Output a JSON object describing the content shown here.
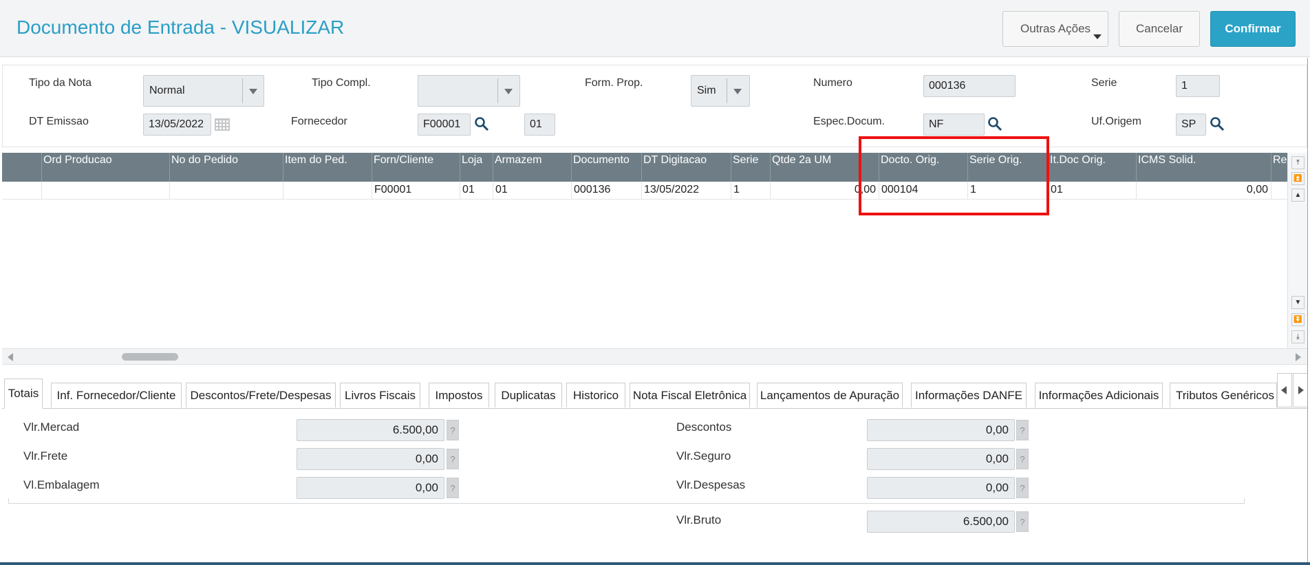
{
  "header": {
    "title": "Documento de Entrada - VISUALIZAR",
    "btn_outras": "Outras Ações",
    "btn_cancel": "Cancelar",
    "btn_confirm": "Confirmar"
  },
  "form": {
    "tipo_nota_label": "Tipo da Nota",
    "tipo_nota_value": "Normal",
    "tipo_compl_label": "Tipo Compl.",
    "tipo_compl_value": "",
    "form_prop_label": "Form. Prop.",
    "form_prop_value": "Sim",
    "numero_label": "Numero",
    "numero_value": "000136",
    "serie_label": "Serie",
    "serie_value": "1",
    "dt_emissao_label": "DT Emissao",
    "dt_emissao_value": "13/05/2022",
    "fornecedor_label": "Fornecedor",
    "fornecedor_value": "F00001",
    "loja_value": "01",
    "espec_label": "Espec.Docum.",
    "espec_value": "NF",
    "uf_label": "Uf.Origem",
    "uf_value": "SP"
  },
  "grid": {
    "columns": [
      "",
      "Ord Producao",
      "No do Pedido",
      "Item do Ped.",
      "Forn/Cliente",
      "Loja",
      "Armazem",
      "Documento",
      "DT Digitacao",
      "Serie",
      "Qtde 2a UM",
      "Docto. Orig.",
      "Serie Orig.",
      "It.Doc Orig.",
      "ICMS Solid.",
      "Re"
    ],
    "row": [
      "",
      "",
      "",
      "",
      "F00001",
      "01",
      "01",
      "000136",
      "13/05/2022",
      "1",
      "0,00",
      "000104",
      "1",
      "01",
      "0,00",
      ""
    ]
  },
  "tabs": [
    "Totais",
    "Inf. Fornecedor/Cliente",
    "Descontos/Frete/Despesas",
    "Livros Fiscais",
    "Impostos",
    "Duplicatas",
    "Historico",
    "Nota Fiscal Eletrônica",
    "Lançamentos de Apuração",
    "Informações DANFE",
    "Informações Adicionais",
    "Tributos Genéricos -"
  ],
  "totals": {
    "vlr_mercad_label": "Vlr.Mercad",
    "vlr_mercad_value": "6.500,00",
    "vlr_frete_label": "Vlr.Frete",
    "vlr_frete_value": "0,00",
    "vl_embalagem_label": "Vl.Embalagem",
    "vl_embalagem_value": "0,00",
    "descontos_label": "Descontos",
    "descontos_value": "0,00",
    "vlr_seguro_label": "Vlr.Seguro",
    "vlr_seguro_value": "0,00",
    "vlr_despesas_label": "Vlr.Despesas",
    "vlr_despesas_value": "0,00",
    "vlr_bruto_label": "Vlr.Bruto",
    "vlr_bruto_value": "6.500,00",
    "help": "?"
  }
}
